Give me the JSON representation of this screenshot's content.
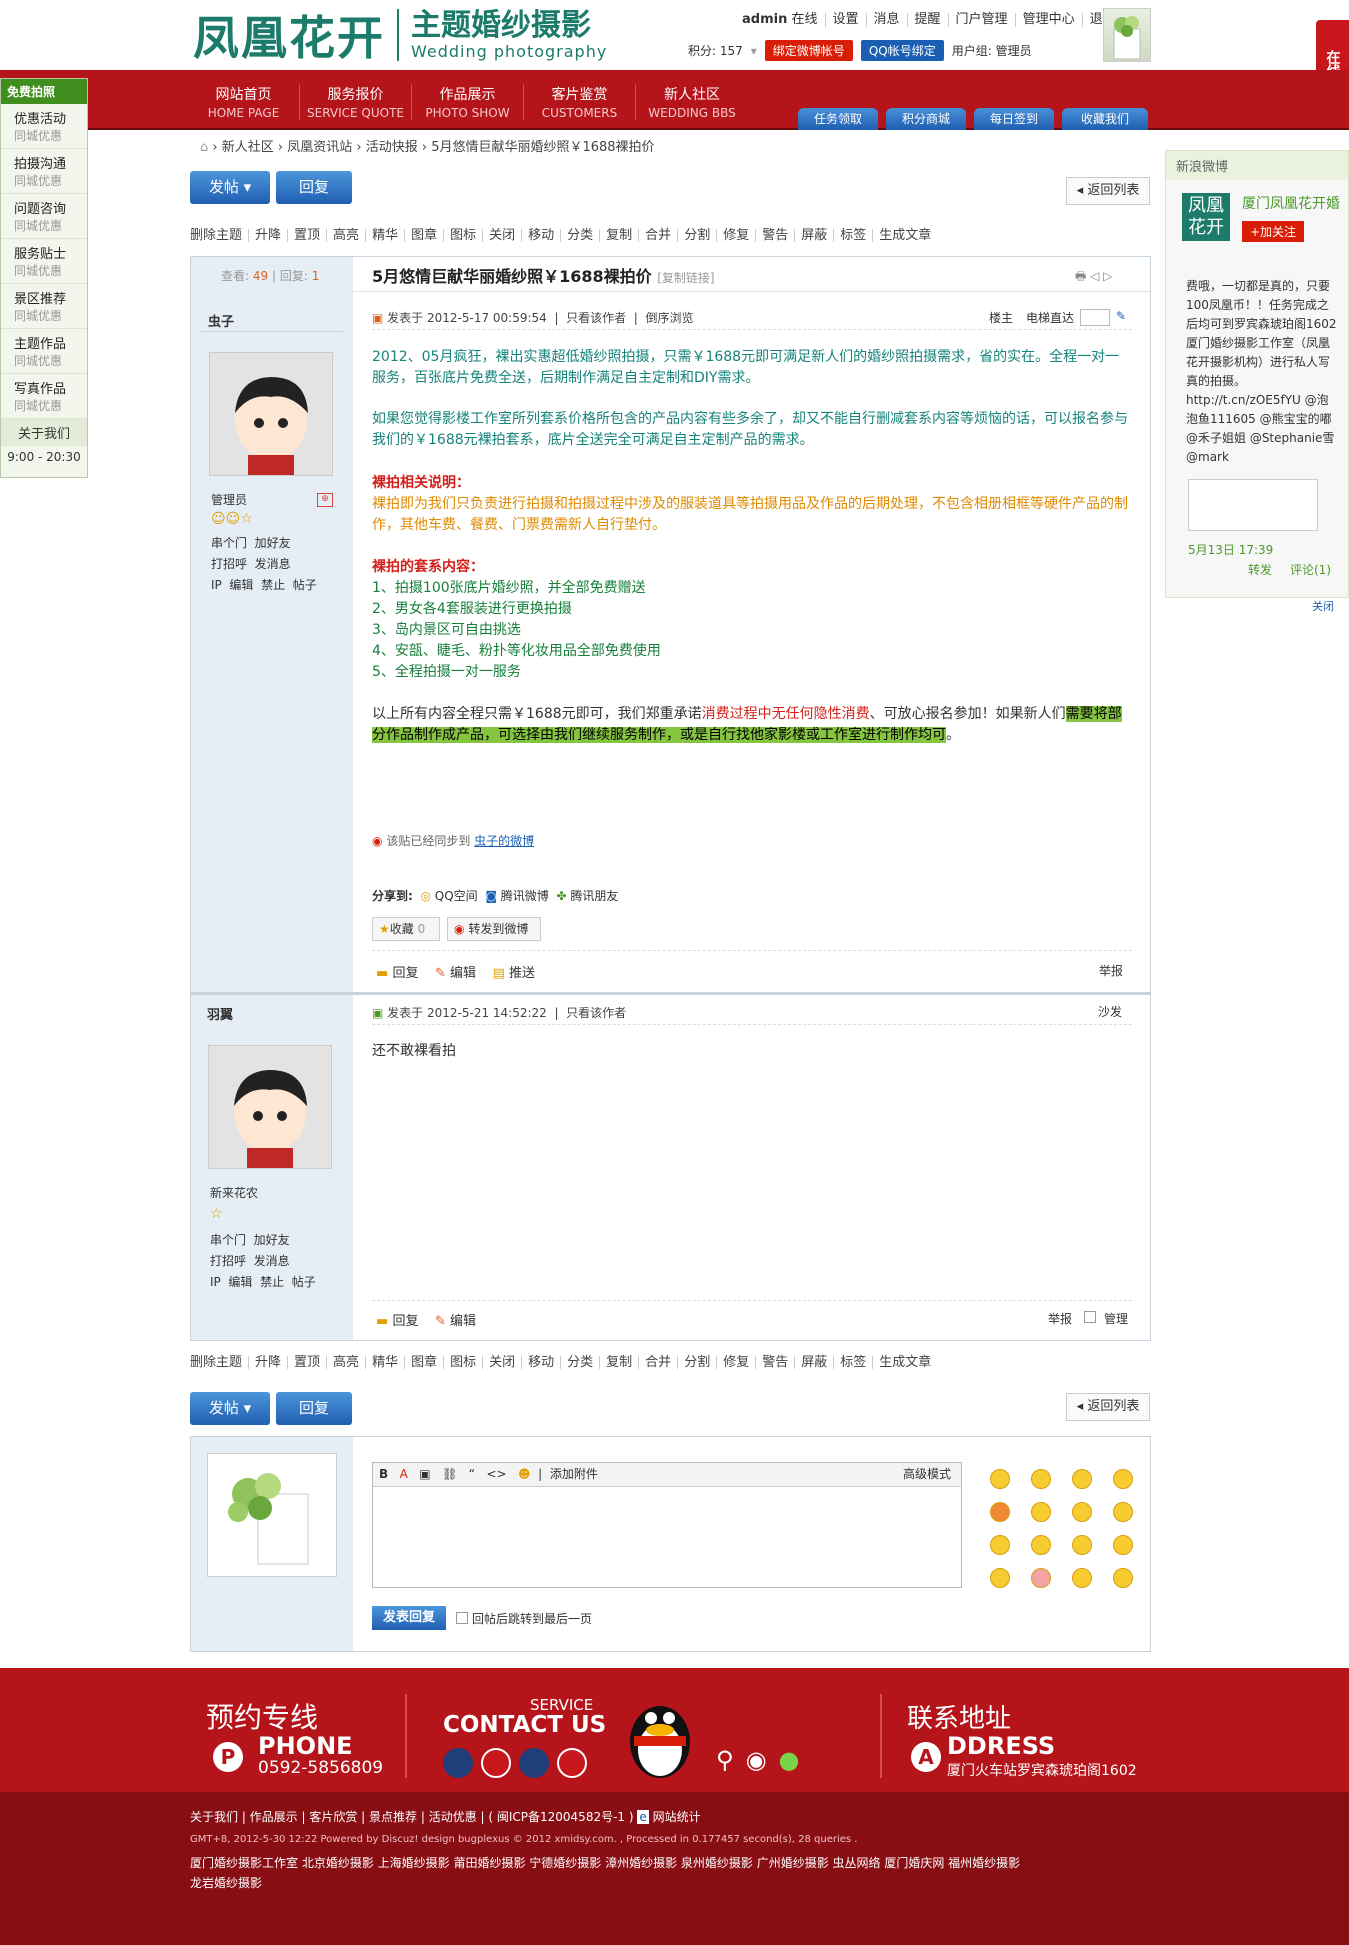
{
  "header": {
    "logo_cn": "凤凰花开",
    "logo_title": "主题婚纱摄影",
    "logo_en": "Wedding photography",
    "user": "admin",
    "online": "在线",
    "links": [
      "设置",
      "消息",
      "提醒",
      "门户管理",
      "管理中心",
      "退出"
    ],
    "points": "积分: 157",
    "weibo_bind": "绑定微博帐号",
    "qq_bind": "QQ帐号绑定",
    "usergroup": "用户组: 管理员"
  },
  "nav": {
    "items": [
      {
        "t": "网站首页",
        "s": "HOME PAGE"
      },
      {
        "t": "服务报价",
        "s": "SERVICE QUOTE"
      },
      {
        "t": "作品展示",
        "s": "PHOTO SHOW"
      },
      {
        "t": "客片鉴赏",
        "s": "CUSTOMERS"
      },
      {
        "t": "新人社区",
        "s": "WEDDING BBS"
      }
    ],
    "tabs": [
      "任务领取",
      "积分商城",
      "每日签到",
      "收藏我们"
    ]
  },
  "leftfloat": {
    "header": "免费拍照",
    "items": [
      {
        "a": "优惠活动",
        "b": "同城优惠"
      },
      {
        "a": "拍摄沟通",
        "b": "同城优惠"
      },
      {
        "a": "问题咨询",
        "b": "同城优惠"
      },
      {
        "a": "服务贴士",
        "b": "同城优惠"
      },
      {
        "a": "景区推荐",
        "b": "同城优惠"
      },
      {
        "a": "主题作品",
        "b": "同城优惠"
      },
      {
        "a": "写真作品",
        "b": "同城优惠"
      }
    ],
    "about": "关于我们",
    "hours": "9:00 - 20:30"
  },
  "rightfloat": {
    "label": "在线客服"
  },
  "weibo": {
    "header": "新浪微博",
    "name": "厦门凤凰花开婚",
    "logo": "凤凰花开",
    "follow": "+加关注",
    "text": "费哦，一切都是真的，只要100凤凰币！！任务完成之后均可到罗宾森琥珀阁1602 厦门婚纱摄影工作室（凤凰花开摄影机构）进行私人写真的拍摄。 http://t.cn/zOE5fYU @泡泡鱼111605 @熊宝宝的嘟 @禾子姐姐 @Stephanie雪@mark",
    "time": "5月13日 17:39",
    "forward": "转发",
    "comment": "评论(1)",
    "close": "关闭"
  },
  "breadcrumb": [
    "新人社区",
    "凤凰资讯站",
    "活动快报",
    "5月悠情巨献华丽婚纱照￥1688裸拍价"
  ],
  "buttons": {
    "post": "发帖",
    "reply": "回复",
    "back": "返回列表"
  },
  "modbar": [
    "删除主题",
    "升降",
    "置顶",
    "高亮",
    "精华",
    "图章",
    "图标",
    "关闭",
    "移动",
    "分类",
    "复制",
    "合并",
    "分割",
    "修复",
    "警告",
    "屏蔽",
    "标签",
    "生成文章"
  ],
  "thread": {
    "views_label": "查看:",
    "views": "49",
    "replies_label": "回复:",
    "replies": "1",
    "title": "5月悠情巨献华丽婚纱照￥1688裸拍价",
    "copy": "[复制链接]"
  },
  "post1": {
    "author": "虫子",
    "group": "管理员",
    "links": [
      "串个门",
      "加好友",
      "打招呼",
      "发消息"
    ],
    "admin": [
      "IP",
      "编辑",
      "禁止",
      "帖子"
    ],
    "meta": "发表于 2012-5-17 00:59:54",
    "only": "只看该作者",
    "rev": "倒序浏览",
    "floor": "楼主",
    "jump": "电梯直达",
    "p1": "2012、05月疯狂，裸出实惠超低婚纱照拍摄，只需￥1688元即可满足新人们的婚纱照拍摄需求，省的实在。全程一对一服务，百张底片免费全送，后期制作满足自主定制和DIY需求。",
    "p2": "如果您觉得影楼工作室所列套系价格所包含的产品内容有些多余了，却又不能自行删减套系内容等烦恼的话，可以报名参与我们的￥1688元裸拍套系，底片全送完全可满足自主定制产品的需求。",
    "h1": "裸拍相关说明：",
    "p3": "裸拍即为我们只负责进行拍摄和拍摄过程中涉及的服装道具等拍摄用品及作品的后期处理，不包含相册相框等硬件产品的制作，其他车费、餐费、门票费需新人自行垫付。",
    "h2": "裸拍的套系内容：",
    "list": [
      "1、拍摄100张底片婚纱照，并全部免费赠送",
      "2、男女各4套服装进行更换拍摄",
      "3、岛内景区可自由挑选",
      "4、安瓿、睫毛、粉扑等化妆用品全部免费使用",
      "5、全程拍摄一对一服务"
    ],
    "p4a": "以上所有内容全程只需￥1688元即可，我们郑重承诺",
    "p4b": "消费过程中无任何隐性消费",
    "p4c": "、可放心报名参加！如果新人们",
    "p4d": "需要将部分作品制作成产品，可选择由我们继续服务制作，或是自行找他家影楼或工作室进行制作均可",
    "p4e": "。",
    "sync": "该贴已经同步到",
    "sync_link": "虫子的微博",
    "share": "分享到:",
    "share_items": [
      "QQ空间",
      "腾讯微博",
      "腾讯朋友"
    ],
    "fav": "收藏",
    "fav_count": "0",
    "toweibo": "转发到微博",
    "actions": [
      "回复",
      "编辑",
      "推送"
    ],
    "report": "举报"
  },
  "post2": {
    "author": "羽翼",
    "group": "新来花农",
    "meta": "发表于 2012-5-21 14:52:22",
    "only": "只看该作者",
    "floor": "沙发",
    "body": "还不敢裸看拍",
    "actions": [
      "回复",
      "编辑"
    ],
    "report": "举报",
    "manage": "管理"
  },
  "editor": {
    "attach": "添加附件",
    "advanced": "高级模式",
    "submit": "发表回复",
    "jump": "回帖后跳转到最后一页"
  },
  "footer": {
    "booking": "预约专线",
    "phone_label": "PHONE",
    "phone": "0592-5856809",
    "service": "SERVICE",
    "contact": "CONTACT US",
    "address_cn": "联系地址",
    "address_label": "DDRESS",
    "address": "厦门火车站罗宾森琥珀阁1602",
    "links": "关于我们 | 作品展示 | 客片欣赏 | 景点推荐 | 活动优惠 | ( 闽ICP备12004582号-1 )",
    "stat": "网站统计",
    "powered": "GMT+8, 2012-5-30 12:22 Powered by Discuz! design bugplexus © 2012 xmidsy.com. , Processed in 0.177457 second(s), 28 queries .",
    "cities1": "厦门婚纱摄影工作室  北京婚纱摄影  上海婚纱摄影  莆田婚纱摄影  宁德婚纱摄影  漳州婚纱摄影  泉州婚纱摄影  广州婚纱摄影  虫丛网络  厦门婚庆网  福州婚纱摄影",
    "cities2": "龙岩婚纱摄影"
  }
}
